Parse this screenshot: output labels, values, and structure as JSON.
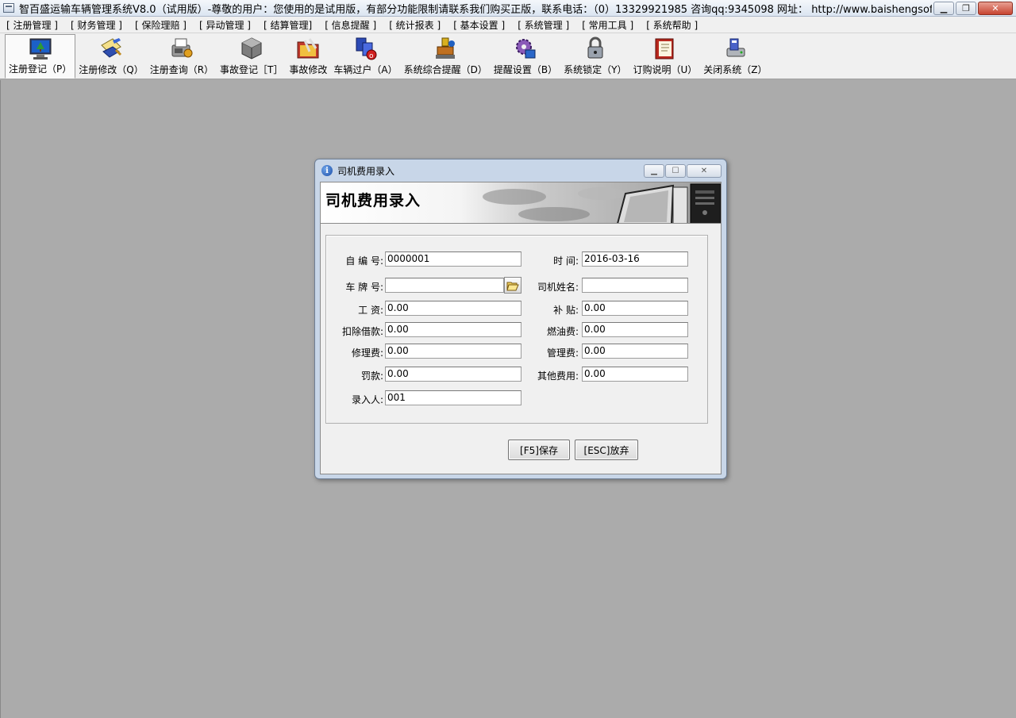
{
  "window": {
    "title": "智百盛运输车辆管理系统V8.0（试用版）-尊敬的用户：您使用的是试用版，有部分功能限制请联系我们购买正版，联系电话：（0）13329921985  咨询qq:9345098   网址： http://www.baishengsoft.com"
  },
  "menu": {
    "items": [
      {
        "label": "[ 注册管理 ]"
      },
      {
        "label": "[ 财务管理 ]"
      },
      {
        "label": "[ 保险理赔 ]"
      },
      {
        "label": "[ 异动管理 ]"
      },
      {
        "label": "[ 结算管理]"
      },
      {
        "label": "[ 信息提醒 ]"
      },
      {
        "label": "[ 统计报表 ]"
      },
      {
        "label": "[ 基本设置 ]"
      },
      {
        "label": "[ 系统管理 ]"
      },
      {
        "label": "[ 常用工具 ]"
      },
      {
        "label": "[ 系统帮助 ]"
      }
    ]
  },
  "toolbar": {
    "items": [
      {
        "label": "注册登记（P）",
        "icon": "monitor-icon"
      },
      {
        "label": "注册修改（Q）",
        "icon": "document-edit-icon"
      },
      {
        "label": "注册查询（R）",
        "icon": "fax-search-icon"
      },
      {
        "label": "事故登记［T］",
        "icon": "box-icon"
      },
      {
        "label": "事故修改",
        "icon": "folder-edit-icon"
      },
      {
        "label": "车辆过户（A）",
        "icon": "transfer-icon"
      },
      {
        "label": "系统综合提醒（D）",
        "icon": "alert-icon"
      },
      {
        "label": "提醒设置（B）",
        "icon": "gear-icon"
      },
      {
        "label": "系统锁定（Y）",
        "icon": "lock-icon"
      },
      {
        "label": "订购说明（U）",
        "icon": "book-icon"
      },
      {
        "label": "关闭系统（Z）",
        "icon": "exit-icon"
      }
    ]
  },
  "dialog": {
    "title": "司机费用录入",
    "banner_title": "司机费用录入",
    "fields": {
      "serial": {
        "label": "自 编 号:",
        "value": "0000001"
      },
      "time": {
        "label": "时    间:",
        "value": "2016-03-16"
      },
      "plate": {
        "label": "车 牌 号:",
        "value": ""
      },
      "driver": {
        "label": "司机姓名:",
        "value": ""
      },
      "salary": {
        "label": "工    资:",
        "value": "0.00"
      },
      "subsidy": {
        "label": "补 贴:",
        "value": "0.00"
      },
      "deduct_loan": {
        "label": "扣除借款:",
        "value": "0.00"
      },
      "fuel": {
        "label": "燃油费:",
        "value": "0.00"
      },
      "repair": {
        "label": "修理费:",
        "value": "0.00"
      },
      "management": {
        "label": "管理费:",
        "value": "0.00"
      },
      "fine": {
        "label": "罚款:",
        "value": "0.00"
      },
      "other": {
        "label": "其他费用:",
        "value": "0.00"
      },
      "entered_by": {
        "label": "录入人:",
        "value": "001"
      }
    },
    "buttons": {
      "save": "[F5]保存",
      "cancel": "[ESC]放弃"
    }
  }
}
